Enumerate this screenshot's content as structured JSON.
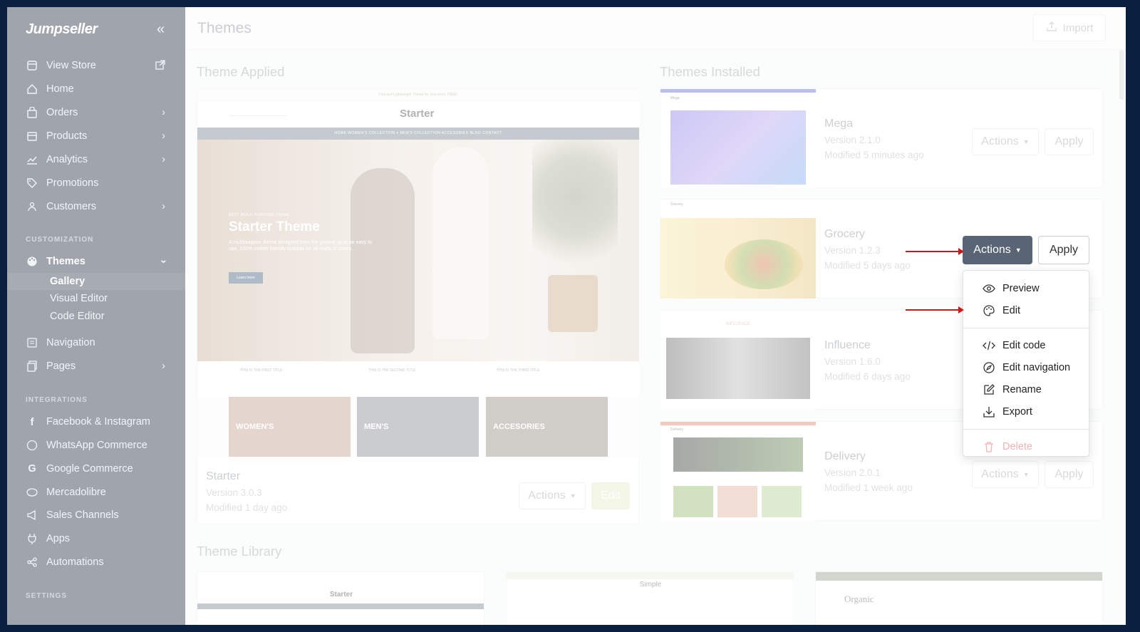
{
  "sidebar": {
    "logo": "Jumpseller",
    "items_top": [
      {
        "label": "View Store",
        "icon": "store-icon"
      },
      {
        "label": "Home",
        "icon": "home-icon"
      },
      {
        "label": "Orders",
        "icon": "bag-icon"
      },
      {
        "label": "Products",
        "icon": "box-icon"
      },
      {
        "label": "Analytics",
        "icon": "chart-icon"
      },
      {
        "label": "Promotions",
        "icon": "tag-icon"
      },
      {
        "label": "Customers",
        "icon": "users-icon"
      }
    ],
    "section_customization": "CUSTOMIZATION",
    "themes_label": "Themes",
    "themes_sub": [
      "Gallery",
      "Visual Editor",
      "Code Editor"
    ],
    "items_mid": [
      {
        "label": "Navigation",
        "icon": "list-icon"
      },
      {
        "label": "Pages",
        "icon": "pages-icon"
      }
    ],
    "section_integrations": "INTEGRATIONS",
    "items_integrations": [
      {
        "label": "Facebook & Instagram",
        "icon": "facebook-icon"
      },
      {
        "label": "WhatsApp Commerce",
        "icon": "whatsapp-icon"
      },
      {
        "label": "Google Commerce",
        "icon": "google-icon"
      },
      {
        "label": "Mercadolibre",
        "icon": "handshake-icon"
      },
      {
        "label": "Sales Channels",
        "icon": "megaphone-icon"
      },
      {
        "label": "Apps",
        "icon": "plug-icon"
      },
      {
        "label": "Automations",
        "icon": "share-icon"
      }
    ],
    "section_settings": "SETTINGS"
  },
  "header": {
    "title": "Themes",
    "import_label": "Import"
  },
  "applied": {
    "section_title": "Theme Applied",
    "name": "Starter",
    "version": "Version 3.0.3",
    "modified": "Modified 1 day ago",
    "actions_label": "Actions",
    "edit_label": "Edit",
    "preview": {
      "topline": "Fast and Lightweight Theme for your store, FREE!",
      "brand": "Starter",
      "nav": "HOME   WOMEN'S COLLECTION ▾   MEN'S COLLECTION   ACCESORIES   BLOG   CONTACT",
      "kicker": "BEST MULTI-PURPOSE THEME",
      "heading": "Starter Theme",
      "desc": "A multipurpose theme designed from the ground up to be easy to use, 100% mobile friendly suitable for all kinds of stores.",
      "cta": "Learn more",
      "trust": [
        "THIS IS THE FIRST TITLE",
        "THIS IS THE SECOND TITLE",
        "THIS IS THE THIRD TITLE"
      ],
      "categories": [
        "WOMEN'S",
        "MEN'S",
        "ACCESORIES"
      ]
    }
  },
  "installed": {
    "section_title": "Themes Installed",
    "themes": [
      {
        "name": "Mega",
        "version": "Version 2.1.0",
        "modified": "Modified 5 minutes ago"
      },
      {
        "name": "Grocery",
        "version": "Version 1.2.3",
        "modified": "Modified 5 days ago"
      },
      {
        "name": "Influence",
        "version": "Version 1.6.0",
        "modified": "Modified 6 days ago"
      },
      {
        "name": "Delivery",
        "version": "Version 2.0.1",
        "modified": "Modified 1 week ago"
      }
    ],
    "actions_label": "Actions",
    "apply_label": "Apply",
    "thumb_labels": {
      "mega": "Mega",
      "grocery": "Grocery",
      "influence": "INFLUENCE",
      "delivery": "Delivery"
    }
  },
  "dropdown": {
    "items": [
      {
        "label": "Preview",
        "icon": "eye-icon"
      },
      {
        "label": "Edit",
        "icon": "palette-icon"
      },
      {
        "label": "Edit code",
        "icon": "code-icon"
      },
      {
        "label": "Edit navigation",
        "icon": "compass-icon"
      },
      {
        "label": "Rename",
        "icon": "pencil-icon"
      },
      {
        "label": "Export",
        "icon": "download-icon"
      },
      {
        "label": "Delete",
        "icon": "trash-icon"
      }
    ]
  },
  "library": {
    "section_title": "Theme Library",
    "themes": [
      "Starter",
      "Simple",
      "Organic"
    ]
  },
  "colors": {
    "sidebar_bg": "#2d3748",
    "active_button": "#596574",
    "arrow": "#d01616",
    "frame": "#0b1f3f"
  }
}
